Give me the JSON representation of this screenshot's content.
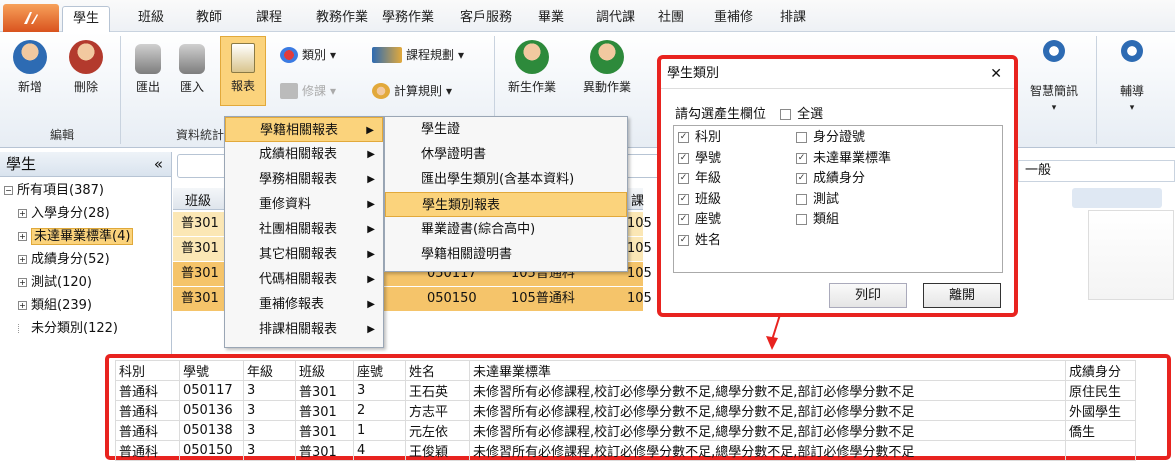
{
  "app_button": "",
  "tabs": [
    "學生",
    "班級",
    "教師",
    "課程",
    "教務作業",
    "學務作業",
    "客戶服務",
    "畢業",
    "調代課",
    "社團",
    "重補修",
    "排課"
  ],
  "ribbon": {
    "add": "新增",
    "delete": "刪除",
    "group_edit": "編輯",
    "export": "匯出",
    "import": "匯入",
    "report": "報表",
    "group_data": "資料統計",
    "category": "類別",
    "course_plan": "課程規劃",
    "retake": "修課",
    "calc_rule": "計算規則",
    "new_student": "新生作業",
    "transfer": "異動作業",
    "smart_sms": "智慧簡訊",
    "tutoring": "輔導"
  },
  "left": {
    "title": "學生",
    "collapse": "«",
    "root": "所有項目(387)",
    "items": [
      "入學身分(28)",
      "未達畢業標準(4)",
      "成績身分(52)",
      "測試(120)",
      "類組(239)",
      "未分類別(122)"
    ]
  },
  "center": {
    "header_class": "班級",
    "header_extra": "課程",
    "rows": [
      {
        "cls": "普301",
        "num": "",
        "dept": "",
        "tail": "105"
      },
      {
        "cls": "普301",
        "num": "",
        "dept": "",
        "tail": "105"
      },
      {
        "cls": "普301",
        "num": "050117",
        "dept": "105普通科",
        "tail": "105"
      },
      {
        "cls": "普301",
        "num": "050150",
        "dept": "105普通科",
        "tail": "105"
      }
    ]
  },
  "menu1": [
    "學籍相關報表",
    "成績相關報表",
    "學務相關報表",
    "重修資料",
    "社團相關報表",
    "其它相關報表",
    "代碼相關報表",
    "重補修報表",
    "排課相關報表"
  ],
  "menu2": [
    "學生證",
    "休學證明書",
    "匯出學生類別(含基本資料)",
    "學生類別報表",
    "畢業證書(綜合高中)",
    "學籍相關證明書"
  ],
  "dialog": {
    "title": "學生類別",
    "close": "✕",
    "prompt": "請勾選產生欄位",
    "select_all": "全選",
    "left_opts": [
      {
        "label": "科別",
        "on": true
      },
      {
        "label": "學號",
        "on": true
      },
      {
        "label": "年級",
        "on": true
      },
      {
        "label": "班級",
        "on": true
      },
      {
        "label": "座號",
        "on": true
      },
      {
        "label": "姓名",
        "on": true
      }
    ],
    "right_opts": [
      {
        "label": "身分證號",
        "on": false
      },
      {
        "label": "未達畢業標準",
        "on": true
      },
      {
        "label": "成績身分",
        "on": true
      },
      {
        "label": "測試",
        "on": false
      },
      {
        "label": "類組",
        "on": false
      }
    ],
    "print": "列印",
    "leave": "離開"
  },
  "right_bg": {
    "general": "一般"
  },
  "result": {
    "headers": [
      "科別",
      "學號",
      "年級",
      "班級",
      "座號",
      "姓名",
      "未達畢業標準",
      "成績身分"
    ],
    "rows": [
      [
        "普通科",
        "050117",
        "3",
        "普301",
        "3",
        "王石英",
        "未修習所有必修課程,校訂必修學分數不足,總學分數不足,部訂必修學分數不足",
        "原住民生"
      ],
      [
        "普通科",
        "050136",
        "3",
        "普301",
        "2",
        "方志平",
        "未修習所有必修課程,校訂必修學分數不足,總學分數不足,部訂必修學分數不足",
        "外國學生"
      ],
      [
        "普通科",
        "050138",
        "3",
        "普301",
        "1",
        "元左依",
        "未修習所有必修課程,校訂必修學分數不足,總學分數不足,部訂必修學分數不足",
        "僑生"
      ],
      [
        "普通科",
        "050150",
        "3",
        "普301",
        "4",
        "王俊穎",
        "未修習所有必修課程,校訂必修學分數不足,總學分數不足,部訂必修學分數不足",
        ""
      ]
    ]
  },
  "colors": {
    "highlight": "#fbd37c",
    "annotation_red": "#e8231f",
    "accent": "#d9531e"
  }
}
